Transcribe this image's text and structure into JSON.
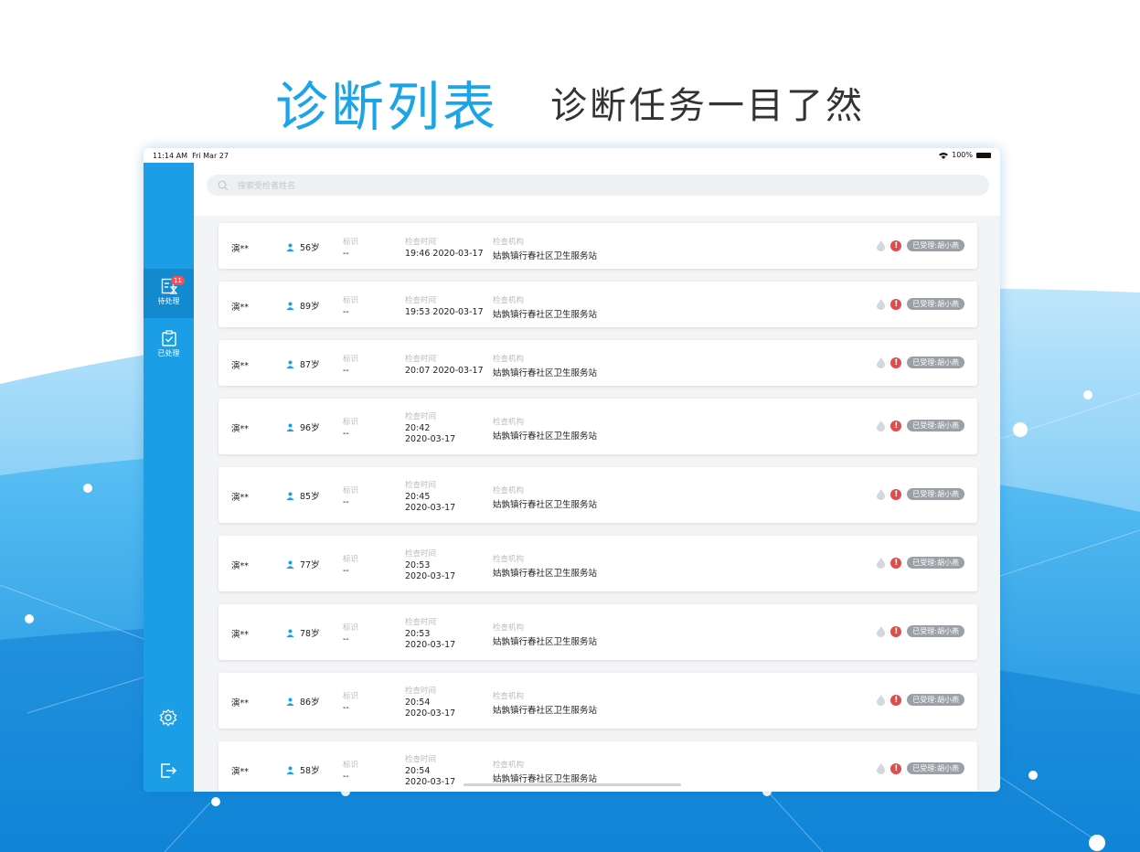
{
  "headline": {
    "title": "诊断列表",
    "subtitle": "诊断任务一目了然"
  },
  "status_bar": {
    "time": "11:14 AM",
    "date": "Fri Mar 27",
    "battery": "100%"
  },
  "sidebar": {
    "items": [
      {
        "label": "待处理",
        "badge": "11",
        "icon": "pending-list-icon"
      },
      {
        "label": "已处理",
        "icon": "processed-clipboard-icon"
      }
    ],
    "bottom_icons": [
      "gear-icon",
      "logout-icon"
    ]
  },
  "search": {
    "placeholder": "搜索受检者姓名"
  },
  "columns": {
    "mark": "标识",
    "time": "检查时间",
    "org": "检查机构"
  },
  "rows": [
    {
      "name": "演**",
      "age": "56岁",
      "mark": "--",
      "time": "19:46 2020-03-17",
      "org": "姑孰镇行春社区卫生服务站",
      "tag": "已受理:胡小燕"
    },
    {
      "name": "演**",
      "age": "89岁",
      "mark": "--",
      "time": "19:53 2020-03-17",
      "org": "姑孰镇行春社区卫生服务站",
      "tag": "已受理:胡小燕"
    },
    {
      "name": "演**",
      "age": "87岁",
      "mark": "--",
      "time": "20:07 2020-03-17",
      "org": "姑孰镇行春社区卫生服务站",
      "tag": "已受理:胡小燕"
    },
    {
      "name": "演**",
      "age": "96岁",
      "mark": "--",
      "time_clock": "20:42",
      "time_date": "2020-03-17",
      "org": "姑孰镇行春社区卫生服务站",
      "tag": "已受理:胡小燕"
    },
    {
      "name": "演**",
      "age": "85岁",
      "mark": "--",
      "time_clock": "20:45",
      "time_date": "2020-03-17",
      "org": "姑孰镇行春社区卫生服务站",
      "tag": "已受理:胡小燕"
    },
    {
      "name": "演**",
      "age": "77岁",
      "mark": "--",
      "time_clock": "20:53",
      "time_date": "2020-03-17",
      "org": "姑孰镇行春社区卫生服务站",
      "tag": "已受理:胡小燕"
    },
    {
      "name": "演**",
      "age": "78岁",
      "mark": "--",
      "time_clock": "20:53",
      "time_date": "2020-03-17",
      "org": "姑孰镇行春社区卫生服务站",
      "tag": "已受理:胡小燕"
    },
    {
      "name": "演**",
      "age": "86岁",
      "mark": "--",
      "time_clock": "20:54",
      "time_date": "2020-03-17",
      "org": "姑孰镇行春社区卫生服务站",
      "tag": "已受理:胡小燕"
    },
    {
      "name": "演**",
      "age": "58岁",
      "mark": "--",
      "time_clock": "20:54",
      "time_date": "2020-03-17",
      "org": "姑孰镇行春社区卫生服务站",
      "tag": "已受理:胡小燕"
    }
  ],
  "colors": {
    "accent": "#1b9ee5",
    "title": "#1ba4e8",
    "warning": "#e04b4b",
    "tag": "#9aa0a6"
  }
}
